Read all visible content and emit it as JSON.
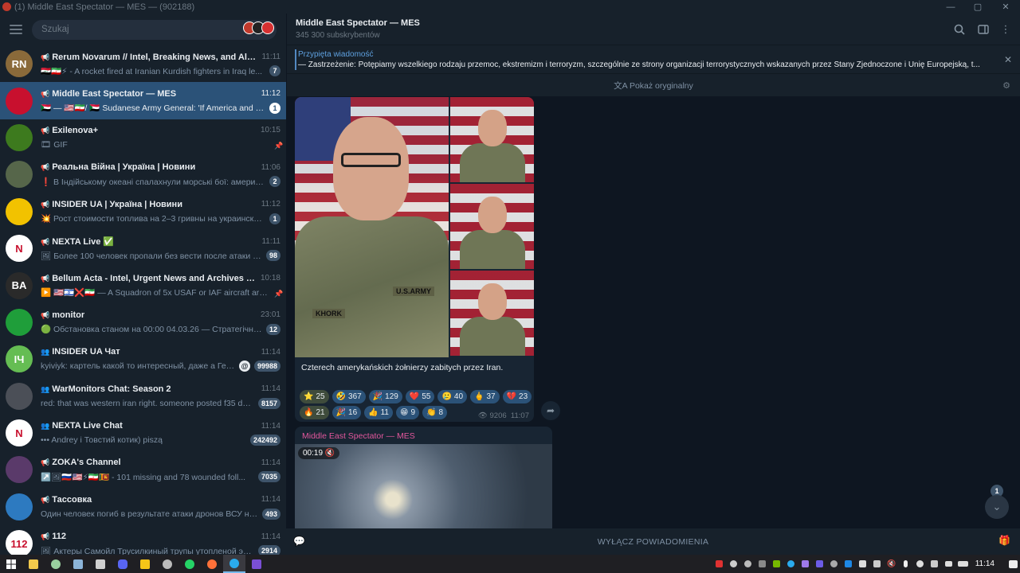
{
  "window": {
    "title": "(1) Middle East Spectator — MES — (902188)"
  },
  "sidebar": {
    "search_placeholder": "Szukaj",
    "chats": [
      {
        "name": "Rerum Novarum // Intel, Breaking News, and Alerts 🇺🇸",
        "time": "11:11",
        "preview": "🇮🇶🇮🇷⚡ - A rocket fired at Iranian Kurdish fighters in Iraq le...",
        "badge": "7",
        "avatar_text": "RN",
        "avatar_color": "#8a6a3a",
        "type": "channel"
      },
      {
        "name": "Middle East Spectator — MES",
        "time": "11:12",
        "preview": "🇸🇩 — 🇺🇸🇮🇷/ 🇸🇩 Sudanese Army General: 'If America and Isr...",
        "badge": "1",
        "avatar_text": "",
        "avatar_color": "#c8102e",
        "type": "channel",
        "active": true
      },
      {
        "name": "Exilenova+",
        "time": "10:15",
        "preview": "🎞 GIF",
        "badge": "",
        "pinned": true,
        "avatar_text": "",
        "avatar_color": "#3d7a1e",
        "type": "channel"
      },
      {
        "name": "Реальна Війна | Україна | Новини",
        "time": "11:06",
        "preview": "❗ В Індійському океані спалахнули морські бої: американ...",
        "badge": "2",
        "avatar_text": "",
        "avatar_color": "#56664a",
        "type": "channel"
      },
      {
        "name": "INSIDER UA | Україна | Новини",
        "time": "11:12",
        "preview": "💥 Рост стоимости топлива на 2–3 гривны на украинских ...",
        "badge": "1",
        "avatar_text": "",
        "avatar_color": "#f2c200",
        "type": "channel"
      },
      {
        "name": "NEXTA Live ✅",
        "time": "11:11",
        "preview": "🖼 Более 100 человек пропали без вести после атаки под...",
        "badge": "98",
        "avatar_text": "N",
        "avatar_color": "#ffffff",
        "type": "channel"
      },
      {
        "name": "Bellum Acta - Intel, Urgent News and Archives ✝️ #Fre...",
        "time": "10:18",
        "preview": "▶️ 🇺🇸🇮🇱❌🇮🇷 — A Squadron of 5x USAF or IAF aircraft are ...",
        "badge": "",
        "pinned": true,
        "avatar_text": "BA",
        "avatar_color": "#2a2a2a",
        "type": "channel"
      },
      {
        "name": "monitor",
        "time": "23:01",
        "preview": "🟢 Обстановка станом на 00:00 04.03.26 — Стратегічна а...",
        "badge": "12",
        "avatar_text": "",
        "avatar_color": "#1f9e3a",
        "type": "channel"
      },
      {
        "name": "INSIDER UA Чат",
        "time": "11:14",
        "preview": "kyiviyk: картель какой то интересный, даже а Герм...",
        "badge": "99988",
        "mention": true,
        "avatar_text": "IЧ",
        "avatar_color": "#65bd53",
        "type": "group"
      },
      {
        "name": "WarMonitors Chat: Season 2",
        "time": "11:14",
        "preview": "red: that was western iran right. someone posted f35 dow...",
        "badge": "8157",
        "avatar_text": "",
        "avatar_color": "#4b4f57",
        "type": "group"
      },
      {
        "name": "NEXTA Live Chat",
        "time": "11:14",
        "preview": "••• Andrey і Товстий котик) piszą",
        "badge": "242492",
        "avatar_text": "N",
        "avatar_color": "#ffffff",
        "type": "group"
      },
      {
        "name": "ZOKA's Channel",
        "time": "11:14",
        "preview": "↗️🖼🇷🇺🇺🇸⚡🇮🇷🇱🇰 - 101 missing and 78 wounded foll...",
        "badge": "7035",
        "avatar_text": "",
        "avatar_color": "#5a3a6a",
        "type": "channel"
      },
      {
        "name": "Тассовка",
        "time": "11:14",
        "preview": "Один человек погиб в результате атаки дронов ВСУ на с...",
        "badge": "493",
        "avatar_text": "",
        "avatar_color": "#2d7ac0",
        "type": "channel"
      },
      {
        "name": "112",
        "time": "11:14",
        "preview": "🖼 Актеры Самойл Трусилкиный трупы утопленой эпохи...",
        "badge": "2914",
        "avatar_text": "112",
        "avatar_color": "#ffffff",
        "type": "channel"
      }
    ]
  },
  "header": {
    "title": "Middle East Spectator — MES",
    "subscribers": "345 300 subskrybentów"
  },
  "pinned": {
    "label": "Przypięta wiadomość",
    "text": "— Zastrzeżenie:   Potępiamy wszelkiego rodzaju przemoc, ekstremizm i terroryzm, szczególnie ze strony organizacji terrorystycznych wskazanych przez Stany Zjednoczone i Unię Europejską, t..."
  },
  "translate": {
    "label": "Pokaż oryginalny"
  },
  "message1": {
    "caption": "Czterech amerykańskich żołnierzy zabitych przez Iran.",
    "name_tag": "KHORK",
    "army_tag": "U.S.ARMY",
    "reactions": [
      {
        "emoji": "⭐",
        "count": "25"
      },
      {
        "emoji": "🤣",
        "count": "367"
      },
      {
        "emoji": "🎉",
        "count": "129"
      },
      {
        "emoji": "❤️",
        "count": "55"
      },
      {
        "emoji": "🥲",
        "count": "40"
      },
      {
        "emoji": "🖕",
        "count": "37"
      },
      {
        "emoji": "💔",
        "count": "23"
      },
      {
        "emoji": "🔥",
        "count": "21"
      },
      {
        "emoji": "🎉",
        "count": "16"
      },
      {
        "emoji": "👍",
        "count": "11"
      },
      {
        "emoji": "😁",
        "count": "9"
      },
      {
        "emoji": "👏",
        "count": "8"
      }
    ],
    "views": "9206",
    "time": "11:07"
  },
  "message2": {
    "author": "Middle East Spectator — MES",
    "duration": "00:19"
  },
  "scroll": {
    "unread": "1"
  },
  "bottom": {
    "mute_label": "WYŁĄCZ POWIADOMIENIA"
  },
  "taskbar": {
    "clock": "11:14"
  },
  "colors": {
    "accent": "#2b5278",
    "bg": "#0e1621",
    "panel": "#17212b",
    "link": "#5ea0df",
    "author": "#e2579c"
  }
}
